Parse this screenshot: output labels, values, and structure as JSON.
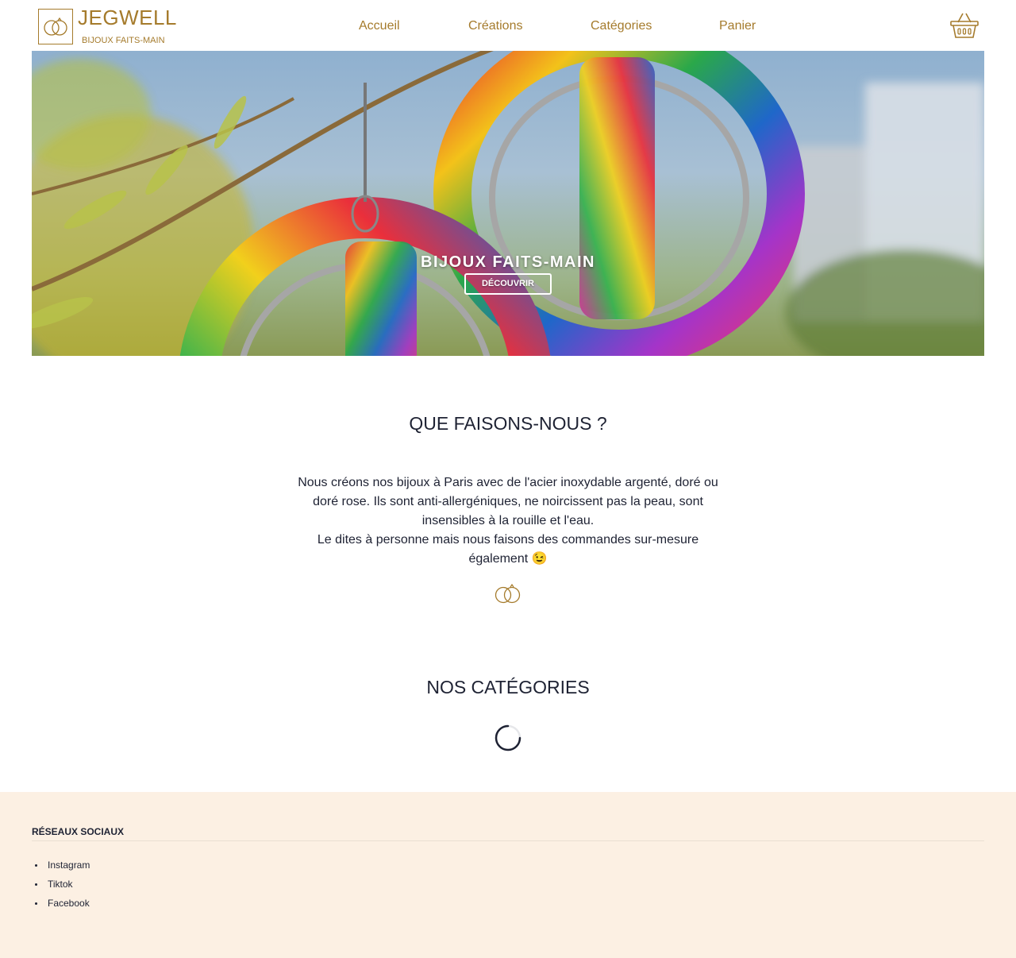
{
  "header": {
    "brand": {
      "name": "JEGWELL",
      "tagline": "BIJOUX FAITS-MAIN",
      "logo_icon": "wedding-rings-icon"
    },
    "nav": [
      "Accueil",
      "Créations",
      "Catégories",
      "Panier"
    ],
    "cart_icon": "shopping-basket-icon"
  },
  "hero": {
    "title": "BIJOUX FAITS-MAIN",
    "button": "DÉCOUVRIR",
    "image": "colorful resin hoop earrings photo"
  },
  "about": {
    "title": "QUE FAISONS-NOUS ?",
    "paragraph1": "Nous créons nos bijoux à Paris avec de l'acier inoxydable argenté, doré ou doré rose. Ils sont anti-allergéniques, ne noircissent pas la peau, sont insensibles à la rouille et l'eau.",
    "paragraph2": "Le dites à personne mais nous faisons des commandes sur-mesure également 😉",
    "divider_icon": "wedding-rings-icon"
  },
  "categories": {
    "title": "NOS CATÉGORIES",
    "loading_icon": "spinner-icon"
  },
  "footer": {
    "title": "RÉSEAUX SOCIAUX",
    "links": [
      "Instagram",
      "Tiktok",
      "Facebook"
    ]
  },
  "colors": {
    "accent": "#a57b2c",
    "text": "#1e2233",
    "footer_bg": "#fcf0e3"
  }
}
